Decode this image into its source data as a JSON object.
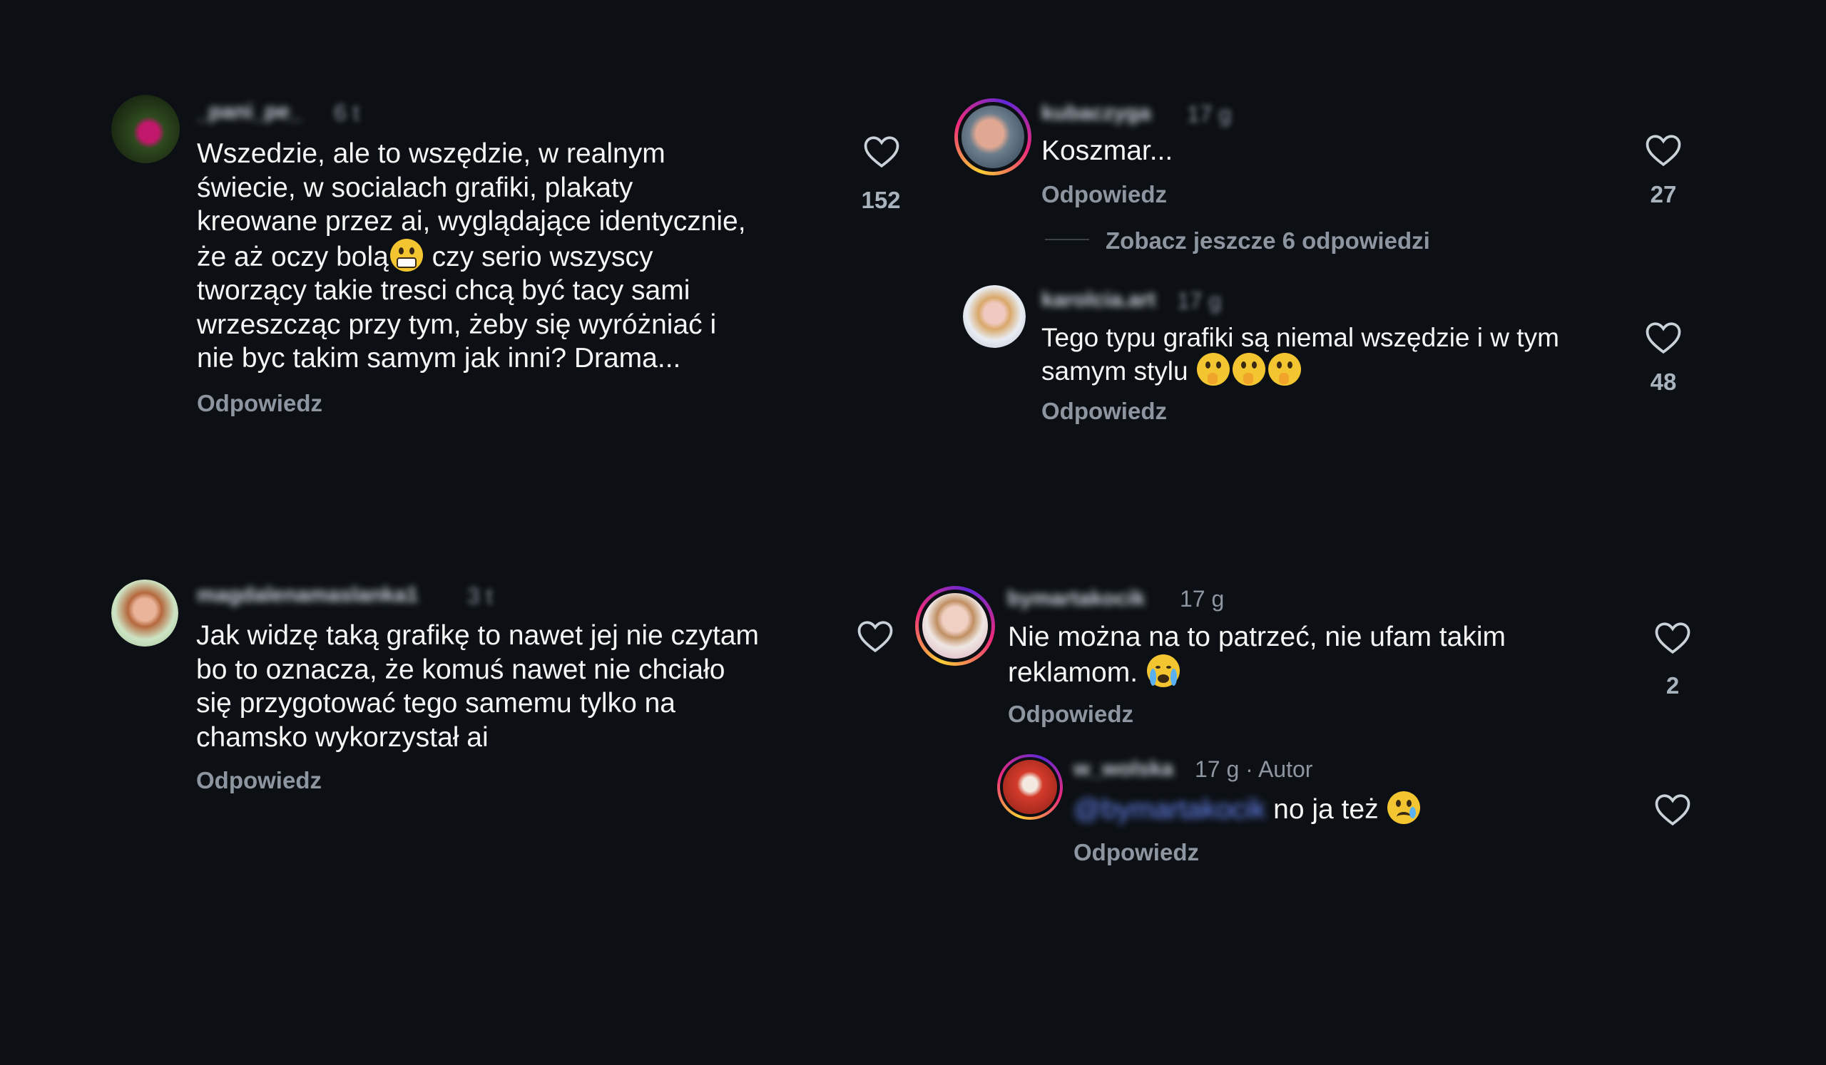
{
  "comments": [
    {
      "username": "_pani_pe_",
      "time": "6 t",
      "text": "Wszedzie, ale to wszędzie, w realnym\nświecie, w socialach grafiki, plakaty\nkreowane przez ai, wyglądające identycznie,\nże aż oczy bolą",
      "text_cont": " czy serio wszyscy\ntworzący takie tresci chcą być tacy sami\nwrzeszcząc przy tym, żeby się wyróżniać i\nnie byc takim samym jak inni? Drama...",
      "reply_label": "Odpowiedz",
      "likes": "152",
      "emoji": "grimacing-face"
    },
    {
      "username": "magdalenamaslanka1",
      "time": "3 t",
      "text": "Jak widzę taką grafikę to nawet jej nie czytam\nbo to oznacza, że komuś nawet nie chciało\nsię przygotować tego samemu tylko na\nchamsko wykorzystał ai",
      "reply_label": "Odpowiedz",
      "likes": ""
    },
    {
      "username": "kubaczyga",
      "time": "17 g",
      "text": "Koszmar...",
      "reply_label": "Odpowiedz",
      "likes": "27",
      "view_replies": "Zobacz jeszcze 6 odpowiedzi"
    },
    {
      "username": "karolcia.art",
      "time": "17 g",
      "text": "Tego typu grafiki są niemal wszędzie i w tym\nsamym stylu ",
      "reply_label": "Odpowiedz",
      "likes": "48",
      "emoji": "face-with-open-eyes-and-hand-over-mouth"
    },
    {
      "username": "bymartakocik",
      "time": "17 g",
      "text": "Nie można na to patrzeć, nie ufam takim\nreklamom. ",
      "reply_label": "Odpowiedz",
      "likes": "2",
      "emoji": "loudly-crying-face"
    },
    {
      "username": "w_wolska",
      "time": "17 g · Autor",
      "mention": "@bymartakocik",
      "text": " no ja też ",
      "reply_label": "Odpowiedz",
      "likes": "",
      "emoji": "crying-face"
    }
  ],
  "colors": {
    "background": "#0c1014",
    "text": "#f5f5f5",
    "secondary": "#8d96a0",
    "mention": "#6c8cff"
  }
}
